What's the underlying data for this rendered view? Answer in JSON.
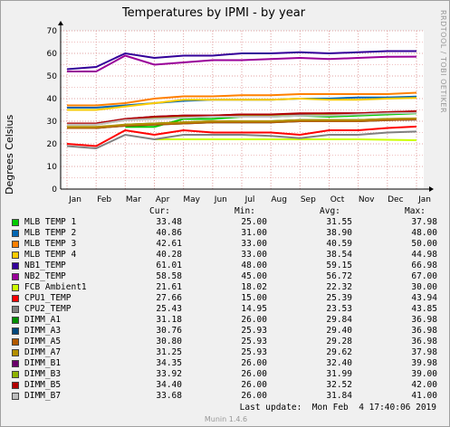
{
  "title": "Temperatures by IPMI - by year",
  "watermark": "RRDTOOL / TOBI OETIKER",
  "footer": {
    "last_update": "Last update:  Mon Feb  4 17:40:06 2019",
    "version": "Munin 1.4.6"
  },
  "legend_headers": {
    "cur": "Cur:",
    "min": "Min:",
    "avg": "Avg:",
    "max": "Max:"
  },
  "colors": {
    "canvas": "#ffffff",
    "background": "#f0f0f0",
    "grid_major": "#e0a0a0",
    "grid_minor": "#f0c0c0"
  },
  "chart_data": {
    "type": "line",
    "title": "Temperatures by IPMI - by year",
    "ylabel": "Degrees Celsius",
    "xlabel": "",
    "ylim": [
      0,
      70
    ],
    "y_ticks": [
      0,
      10,
      20,
      30,
      40,
      50,
      60,
      70
    ],
    "x_ticks": [
      "Jan",
      "Feb",
      "Mar",
      "Apr",
      "May",
      "Jun",
      "Jul",
      "Aug",
      "Sep",
      "Oct",
      "Nov",
      "Dec",
      "Jan"
    ],
    "grid": true,
    "series": [
      {
        "name": "MLB TEMP 1",
        "color": "#00cc00",
        "cur": "33.48",
        "min": "25.00",
        "avg": "31.55",
        "max": "37.98",
        "values": [
          null,
          null,
          27.5,
          27.5,
          31.0,
          31.0,
          32.0,
          32.0,
          32.5,
          32.0,
          32.5,
          33.0,
          33.5
        ]
      },
      {
        "name": "MLB TEMP 2",
        "color": "#0066b3",
        "cur": "40.86",
        "min": "31.00",
        "avg": "38.90",
        "max": "48.00",
        "values": [
          36.0,
          36.0,
          37.0,
          38.0,
          39.0,
          39.5,
          39.5,
          39.5,
          40.0,
          40.0,
          40.5,
          40.5,
          40.86
        ]
      },
      {
        "name": "MLB TEMP 3",
        "color": "#ff8000",
        "cur": "42.61",
        "min": "33.00",
        "avg": "40.59",
        "max": "50.00",
        "values": [
          37.0,
          37.0,
          38.0,
          40.0,
          41.0,
          41.0,
          41.5,
          41.5,
          42.0,
          42.0,
          42.0,
          42.0,
          42.61
        ]
      },
      {
        "name": "MLB TEMP 4",
        "color": "#ffcc00",
        "cur": "40.28",
        "min": "33.00",
        "avg": "38.54",
        "max": "44.98",
        "values": [
          35.0,
          35.0,
          36.5,
          38.0,
          39.5,
          39.5,
          39.5,
          39.5,
          40.0,
          39.5,
          39.5,
          40.0,
          40.28
        ]
      },
      {
        "name": "NB1_TEMP",
        "color": "#330099",
        "cur": "61.01",
        "min": "48.00",
        "avg": "59.15",
        "max": "66.98",
        "values": [
          53.0,
          54.0,
          60.0,
          58.0,
          59.0,
          59.0,
          60.0,
          60.0,
          60.5,
          60.0,
          60.5,
          61.0,
          61.01
        ]
      },
      {
        "name": "NB2_TEMP",
        "color": "#990099",
        "cur": "58.58",
        "min": "45.00",
        "avg": "56.72",
        "max": "67.00",
        "values": [
          52.0,
          52.0,
          59.0,
          55.0,
          56.0,
          57.0,
          57.0,
          57.5,
          58.0,
          57.5,
          58.0,
          58.5,
          58.58
        ]
      },
      {
        "name": "FCB Ambient1",
        "color": "#ccff00",
        "cur": "21.61",
        "min": "18.02",
        "avg": "22.32",
        "max": "30.00",
        "values": [
          null,
          null,
          null,
          22.0,
          22.0,
          22.0,
          22.0,
          22.0,
          22.0,
          22.0,
          22.0,
          21.8,
          21.61
        ]
      },
      {
        "name": "CPU1_TEMP",
        "color": "#ff0000",
        "cur": "27.66",
        "min": "15.00",
        "avg": "25.39",
        "max": "43.94",
        "values": [
          20.0,
          19.0,
          26.0,
          24.0,
          26.0,
          25.0,
          25.0,
          25.0,
          24.0,
          26.0,
          26.0,
          27.0,
          27.66
        ]
      },
      {
        "name": "CPU2_TEMP",
        "color": "#808080",
        "cur": "25.43",
        "min": "14.95",
        "avg": "23.53",
        "max": "43.85",
        "values": [
          19.0,
          18.0,
          24.0,
          22.0,
          24.0,
          24.0,
          24.0,
          23.5,
          22.5,
          24.0,
          24.0,
          25.0,
          25.43
        ]
      },
      {
        "name": "DIMM_A1",
        "color": "#008f00",
        "cur": "31.18",
        "min": "26.00",
        "avg": "29.84",
        "max": "36.98",
        "values": [
          27.0,
          27.0,
          28.5,
          29.0,
          29.5,
          30.0,
          30.0,
          30.0,
          30.5,
          30.5,
          30.5,
          31.0,
          31.18
        ]
      },
      {
        "name": "DIMM_A3",
        "color": "#00487d",
        "cur": "30.76",
        "min": "25.93",
        "avg": "29.40",
        "max": "36.98",
        "values": [
          27.0,
          27.0,
          28.0,
          28.5,
          29.0,
          29.5,
          29.5,
          29.5,
          30.0,
          30.0,
          30.0,
          30.5,
          30.76
        ]
      },
      {
        "name": "DIMM_A5",
        "color": "#b35a00",
        "cur": "30.80",
        "min": "25.93",
        "avg": "29.28",
        "max": "36.98",
        "values": [
          27.0,
          27.0,
          28.0,
          28.5,
          29.0,
          29.5,
          29.5,
          29.5,
          30.0,
          30.0,
          30.0,
          30.5,
          30.8
        ]
      },
      {
        "name": "DIMM_A7",
        "color": "#b38f00",
        "cur": "31.25",
        "min": "25.93",
        "avg": "29.62",
        "max": "37.98",
        "values": [
          27.5,
          27.5,
          28.5,
          29.0,
          29.5,
          30.0,
          30.0,
          30.0,
          30.5,
          30.5,
          30.5,
          31.0,
          31.25
        ]
      },
      {
        "name": "DIMM_B1",
        "color": "#6b006b",
        "cur": "34.35",
        "min": "26.00",
        "avg": "32.40",
        "max": "39.98",
        "values": [
          29.0,
          29.0,
          31.0,
          32.0,
          32.5,
          32.5,
          33.0,
          33.0,
          33.0,
          33.5,
          33.5,
          34.0,
          34.35
        ]
      },
      {
        "name": "DIMM_B3",
        "color": "#8fb300",
        "cur": "33.92",
        "min": "26.00",
        "avg": "31.99",
        "max": "39.00",
        "values": [
          28.5,
          28.5,
          30.5,
          31.5,
          32.0,
          32.0,
          32.5,
          32.5,
          32.5,
          33.0,
          33.0,
          33.5,
          33.92
        ]
      },
      {
        "name": "DIMM_B5",
        "color": "#b30000",
        "cur": "34.40",
        "min": "26.00",
        "avg": "32.52",
        "max": "42.00",
        "values": [
          29.0,
          29.0,
          31.0,
          32.0,
          32.5,
          32.5,
          33.0,
          33.0,
          33.5,
          33.5,
          33.5,
          34.0,
          34.4
        ]
      },
      {
        "name": "DIMM_B7",
        "color": "#bebebe",
        "cur": "33.68",
        "min": "26.00",
        "avg": "31.84",
        "max": "41.00",
        "values": [
          28.5,
          28.5,
          30.5,
          31.0,
          31.5,
          32.0,
          32.0,
          32.0,
          32.5,
          32.5,
          33.0,
          33.5,
          33.68
        ]
      }
    ]
  }
}
